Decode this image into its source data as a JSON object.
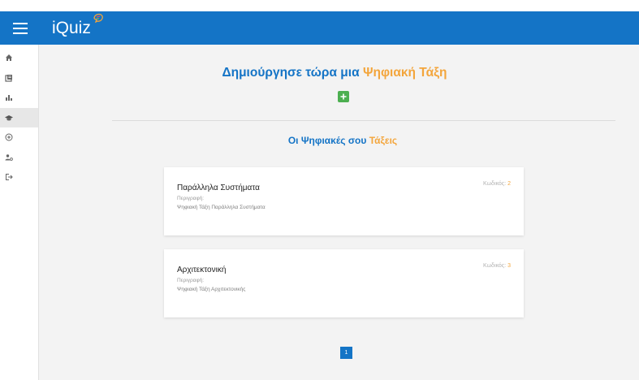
{
  "app": {
    "title": "iQuiz"
  },
  "header": {
    "title_prefix": "Δημιούργησε τώρα μια",
    "title_highlight": "Ψηφιακή Τάξη"
  },
  "section": {
    "title_prefix": "Οι Ψηφιακές σου",
    "title_highlight": "Τάξεις"
  },
  "sidebar": {
    "items": [
      {
        "icon": "home-icon",
        "active": false
      },
      {
        "icon": "library-icon",
        "active": false
      },
      {
        "icon": "bar-chart-icon",
        "active": false
      },
      {
        "icon": "graduation-cap-icon",
        "active": true
      },
      {
        "icon": "add-circle-icon",
        "active": false
      },
      {
        "icon": "user-settings-icon",
        "active": false
      },
      {
        "icon": "logout-icon",
        "active": false
      }
    ]
  },
  "classes": [
    {
      "title": "Παράλληλα Συστήματα",
      "code_label": "Κωδικός:",
      "code": "2",
      "desc_label": "Περιγραφή:",
      "desc": "Ψηφιακή Τάξη Παράλληλα Συστήματα"
    },
    {
      "title": "Αρχιτεκτονική",
      "code_label": "Κωδικός:",
      "code": "3",
      "desc_label": "Περιγραφή:",
      "desc": "Ψηφιακή Τάξη Αρχιτεκτονικής"
    }
  ],
  "pagination": {
    "current": "1"
  },
  "colors": {
    "primary": "#1474c6",
    "accent": "#f3a53b",
    "add_button": "#4caf50"
  }
}
